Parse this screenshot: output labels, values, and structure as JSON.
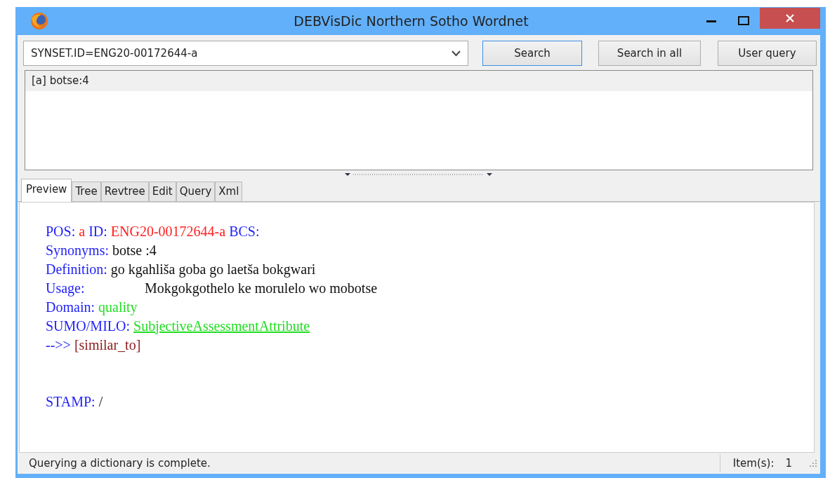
{
  "window": {
    "title": "DEBVisDic Northern Sotho Wordnet"
  },
  "query": {
    "value": "SYNSET.ID=ENG20-00172644-a"
  },
  "buttons": [
    {
      "label": "Search",
      "focused": true
    },
    {
      "label": "Search in all",
      "focused": false
    },
    {
      "label": "User query",
      "focused": false
    }
  ],
  "results": [
    {
      "label": "[a] botse:4",
      "selected": true
    }
  ],
  "tabs": [
    {
      "label": "Preview",
      "selected": true
    },
    {
      "label": "Tree",
      "selected": false
    },
    {
      "label": "Revtree",
      "selected": false
    },
    {
      "label": "Edit",
      "selected": false
    },
    {
      "label": "Query",
      "selected": false
    },
    {
      "label": "Xml",
      "selected": false
    }
  ],
  "preview": [
    [
      {
        "kind": "label",
        "text": "POS:"
      },
      {
        "kind": "id",
        "text": "a"
      },
      {
        "kind": "label",
        "text": "ID:"
      },
      {
        "kind": "id",
        "text": "ENG20-00172644-a"
      },
      {
        "kind": "label",
        "text": "BCS:"
      }
    ],
    [
      {
        "kind": "label",
        "text": "Synonyms:"
      },
      {
        "kind": "value",
        "text": "botse :4"
      }
    ],
    [
      {
        "kind": "label",
        "text": "Definition:"
      },
      {
        "kind": "value",
        "text": "go kgahliša goba go laetša bokgwari"
      }
    ],
    [
      {
        "kind": "tablabel",
        "text": "Usage:"
      },
      {
        "kind": "value",
        "text": "Mokgokgothelo ke morulelo wo mobotse"
      }
    ],
    [
      {
        "kind": "label",
        "text": "Domain:"
      },
      {
        "kind": "domain",
        "text": "quality"
      }
    ],
    [
      {
        "kind": "label",
        "text": "SUMO/MILO:"
      },
      {
        "kind": "link",
        "text": "SubjectiveAssessmentAttribute"
      }
    ],
    [
      {
        "kind": "label",
        "text": "-->>"
      },
      {
        "kind": "relation",
        "text": "[similar_to]"
      }
    ],
    [
      {
        "kind": "spacer"
      },
      {
        "kind": "label",
        "text": "STAMP:"
      },
      {
        "kind": "value",
        "text": "/"
      }
    ]
  ],
  "status_bar": {
    "message": "Querying a dictionary is complete.",
    "items_label": "Item(s):",
    "items_count": "1"
  }
}
